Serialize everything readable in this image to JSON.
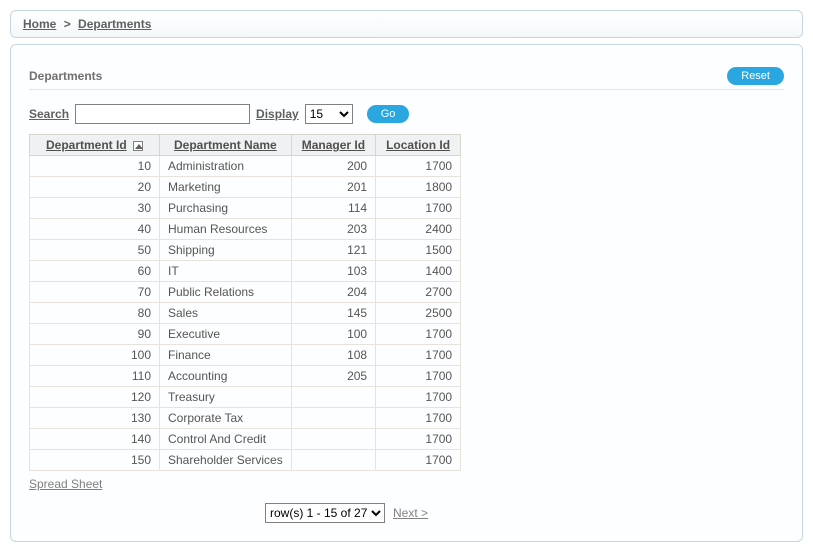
{
  "breadcrumb": {
    "home": "Home",
    "sep": ">",
    "current": "Departments"
  },
  "region": {
    "title": "Departments",
    "reset_label": "Reset"
  },
  "search": {
    "label": "Search",
    "value": "",
    "display_label": "Display",
    "display_value": "15",
    "go_label": "Go"
  },
  "table": {
    "headers": {
      "dept_id": "Department Id",
      "dept_name": "Department Name",
      "manager_id": "Manager Id",
      "location_id": "Location Id"
    },
    "rows": [
      {
        "dept_id": "10",
        "dept_name": "Administration",
        "manager_id": "200",
        "location_id": "1700"
      },
      {
        "dept_id": "20",
        "dept_name": "Marketing",
        "manager_id": "201",
        "location_id": "1800"
      },
      {
        "dept_id": "30",
        "dept_name": "Purchasing",
        "manager_id": "114",
        "location_id": "1700"
      },
      {
        "dept_id": "40",
        "dept_name": "Human Resources",
        "manager_id": "203",
        "location_id": "2400"
      },
      {
        "dept_id": "50",
        "dept_name": "Shipping",
        "manager_id": "121",
        "location_id": "1500"
      },
      {
        "dept_id": "60",
        "dept_name": "IT",
        "manager_id": "103",
        "location_id": "1400"
      },
      {
        "dept_id": "70",
        "dept_name": "Public Relations",
        "manager_id": "204",
        "location_id": "2700"
      },
      {
        "dept_id": "80",
        "dept_name": "Sales",
        "manager_id": "145",
        "location_id": "2500"
      },
      {
        "dept_id": "90",
        "dept_name": "Executive",
        "manager_id": "100",
        "location_id": "1700"
      },
      {
        "dept_id": "100",
        "dept_name": "Finance",
        "manager_id": "108",
        "location_id": "1700"
      },
      {
        "dept_id": "110",
        "dept_name": "Accounting",
        "manager_id": "205",
        "location_id": "1700"
      },
      {
        "dept_id": "120",
        "dept_name": "Treasury",
        "manager_id": "",
        "location_id": "1700"
      },
      {
        "dept_id": "130",
        "dept_name": "Corporate Tax",
        "manager_id": "",
        "location_id": "1700"
      },
      {
        "dept_id": "140",
        "dept_name": "Control And Credit",
        "manager_id": "",
        "location_id": "1700"
      },
      {
        "dept_id": "150",
        "dept_name": "Shareholder Services",
        "manager_id": "",
        "location_id": "1700"
      }
    ]
  },
  "footer": {
    "spreadsheet_label": "Spread Sheet",
    "pager_value": "row(s) 1 - 15 of 27",
    "next_label": "Next >"
  }
}
